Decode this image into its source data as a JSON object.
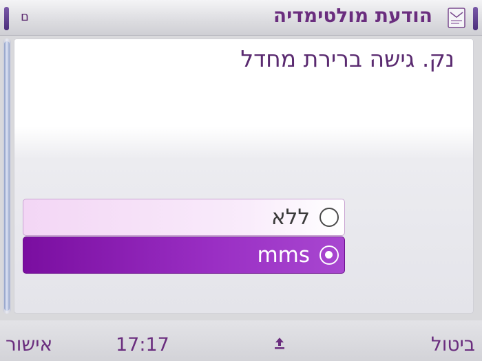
{
  "header": {
    "title": "הודעת מולטימדיה",
    "left_indicator": "ם",
    "icon": "message-envelope-icon"
  },
  "prompt": "נק. גישה ברירת מחדל",
  "options": [
    {
      "label": "ללא",
      "selected": false
    },
    {
      "label": "mms",
      "selected": true
    }
  ],
  "softkeys": {
    "left": "אישור",
    "time": "17:17",
    "middle_icon": "upload-arrow-icon",
    "right": "ביטול"
  },
  "colors": {
    "accent": "#6a2d7e",
    "selection": "#8a1fb4"
  }
}
